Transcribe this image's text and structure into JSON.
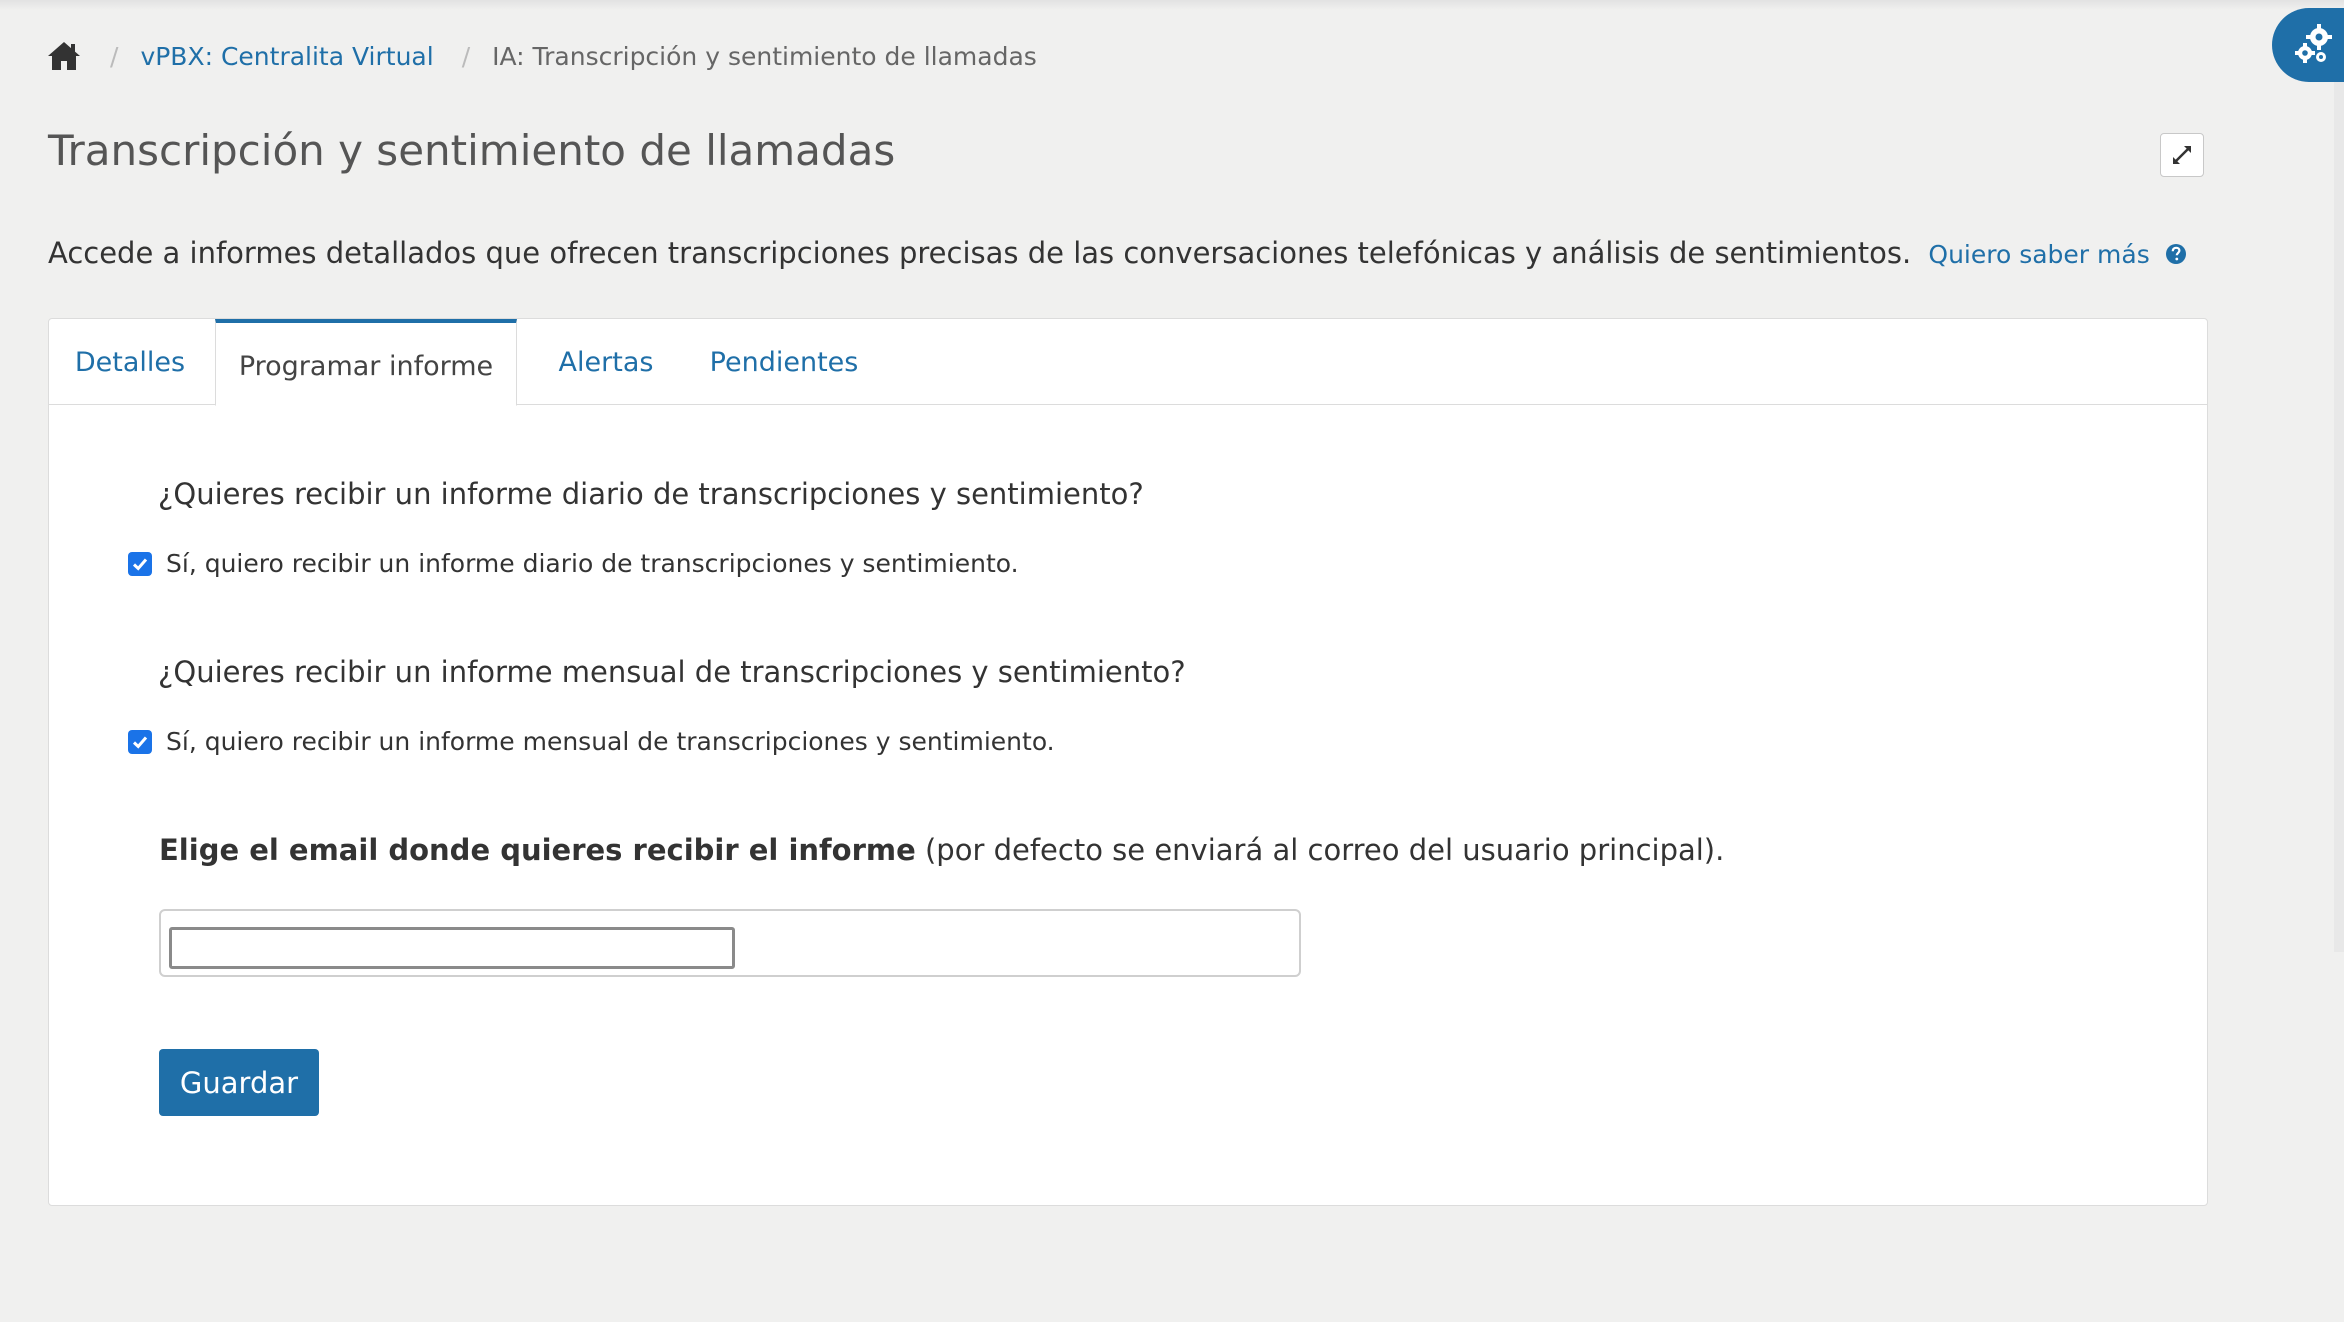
{
  "breadcrumb": {
    "home_icon": "home-icon",
    "items": [
      "vPBX: Centralita Virtual",
      "IA: Transcripción y sentimiento de llamadas"
    ]
  },
  "page": {
    "title": "Transcripción y sentimiento de llamadas",
    "intro": "Accede a informes detallados que ofrecen transcripciones precisas de las conversaciones telefónicas y análisis de sentimientos.",
    "learn_more": "Quiero saber más"
  },
  "tabs": [
    {
      "label": "Detalles",
      "active": false
    },
    {
      "label": "Programar informe",
      "active": true
    },
    {
      "label": "Alertas",
      "active": false
    },
    {
      "label": "Pendientes",
      "active": false
    }
  ],
  "form": {
    "daily_question": "¿Quieres recibir un informe diario de transcripciones y sentimiento?",
    "daily_checkbox_label": "Sí, quiero recibir un informe diario de transcripciones y sentimiento.",
    "daily_checked": true,
    "monthly_question": "¿Quieres recibir un informe mensual de transcripciones y sentimiento?",
    "monthly_checkbox_label": "Sí, quiero recibir un informe mensual de transcripciones y sentimiento.",
    "monthly_checked": true,
    "email_label_bold": "Elige el email donde quieres recibir el informe",
    "email_label_rest": " (por defecto se enviará al correo del usuario principal).",
    "email_value": "",
    "save_label": "Guardar"
  },
  "colors": {
    "accent": "#1f6fa8",
    "checkbox": "#1a73e8",
    "background": "#f0f0ef"
  },
  "icons": {
    "expand": "expand-icon",
    "settings": "gears-icon",
    "help": "question-circle-icon"
  }
}
